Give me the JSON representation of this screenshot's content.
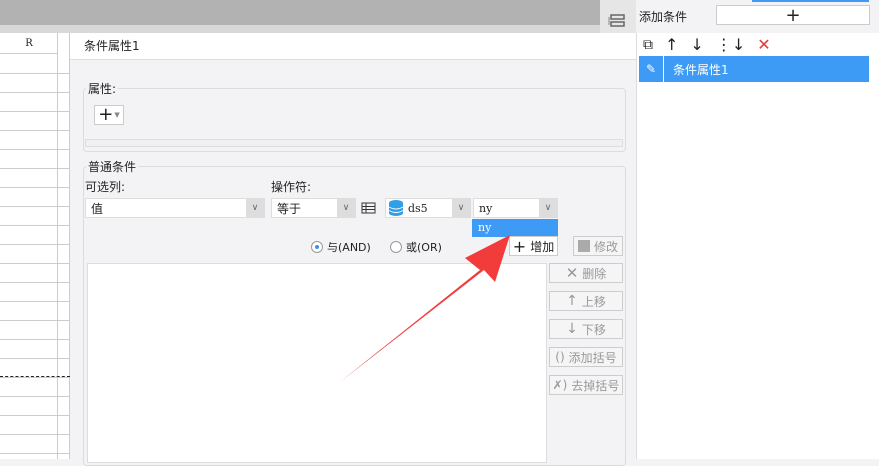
{
  "sheet": {
    "column_header": "R"
  },
  "panel": {
    "title": "条件属性1"
  },
  "attributes": {
    "legend": "属性:",
    "add_icon": "plus-dropdown-icon"
  },
  "common": {
    "legend": "普通条件",
    "column_label": "可选列:",
    "operator_label": "操作符:",
    "column_value": "值",
    "operator_value": "等于",
    "dataset_value": "ds5",
    "field_value": "ny",
    "dropdown_options": [
      "ny"
    ],
    "and_label": "与(AND)",
    "or_label": "或(OR)",
    "add_label": "增加",
    "modify_label": "修改",
    "delete_label": "删除",
    "move_up_label": "上移",
    "move_down_label": "下移",
    "add_bracket_label": "添加括号",
    "remove_bracket_label": "去掉括号"
  },
  "right": {
    "add_condition_label": "添加条件",
    "list": [
      {
        "label": "条件属性1",
        "selected": true
      }
    ]
  },
  "colors": {
    "accent": "#3d9bf5",
    "arrow": "#f23c3c"
  }
}
